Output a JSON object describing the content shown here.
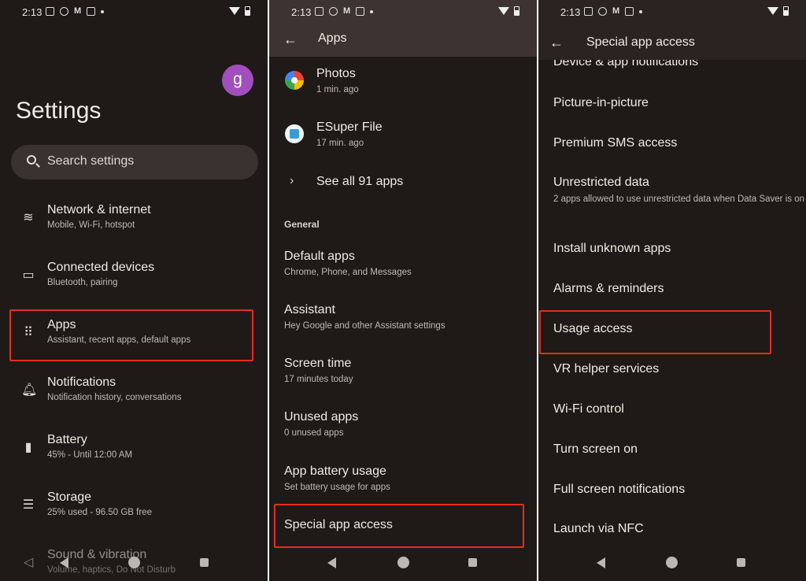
{
  "status_bar": {
    "time": "2:13"
  },
  "settings": {
    "avatar_letter": "g",
    "title": "Settings",
    "search_placeholder": "Search settings",
    "items": [
      {
        "title": "Network & internet",
        "subtitle": "Mobile, Wi-Fi, hotspot",
        "icon": "wifi-icon"
      },
      {
        "title": "Connected devices",
        "subtitle": "Bluetooth, pairing",
        "icon": "devices-icon"
      },
      {
        "title": "Apps",
        "subtitle": "Assistant, recent apps, default apps",
        "icon": "apps-grid-icon"
      },
      {
        "title": "Notifications",
        "subtitle": "Notification history, conversations",
        "icon": "bell-icon"
      },
      {
        "title": "Battery",
        "subtitle": "45% - Until 12:00 AM",
        "icon": "battery-icon"
      },
      {
        "title": "Storage",
        "subtitle": "25% used - 96.50 GB free",
        "icon": "storage-icon"
      },
      {
        "title": "Sound & vibration",
        "subtitle": "Volume, haptics, Do Not Disturb",
        "icon": "volume-icon"
      }
    ]
  },
  "apps": {
    "title": "Apps",
    "recent": [
      {
        "name": "Photos",
        "time": "1 min. ago"
      },
      {
        "name": "ESuper File",
        "time": "17 min. ago"
      }
    ],
    "see_all": "See all 91 apps",
    "section_general": "General",
    "general_items": [
      {
        "title": "Default apps",
        "subtitle": "Chrome, Phone, and Messages"
      },
      {
        "title": "Assistant",
        "subtitle": "Hey Google and other Assistant settings"
      },
      {
        "title": "Screen time",
        "subtitle": "17 minutes today"
      },
      {
        "title": "Unused apps",
        "subtitle": "0 unused apps"
      },
      {
        "title": "App battery usage",
        "subtitle": "Set battery usage for apps"
      },
      {
        "title": "Special app access",
        "subtitle": ""
      }
    ]
  },
  "special_access": {
    "title": "Special app access",
    "items": [
      "Device & app notifications",
      "Picture-in-picture",
      "Premium SMS access",
      "Unrestricted data",
      "Install unknown apps",
      "Alarms & reminders",
      "Usage access",
      "VR helper services",
      "Wi-Fi control",
      "Turn screen on",
      "Full screen notifications",
      "Launch via NFC"
    ],
    "unrestricted_data_sub": "2 apps allowed to use unrestricted data when Data Saver is on"
  },
  "accent": {
    "highlight": "#e0301e",
    "avatar": "#a14fbd"
  }
}
